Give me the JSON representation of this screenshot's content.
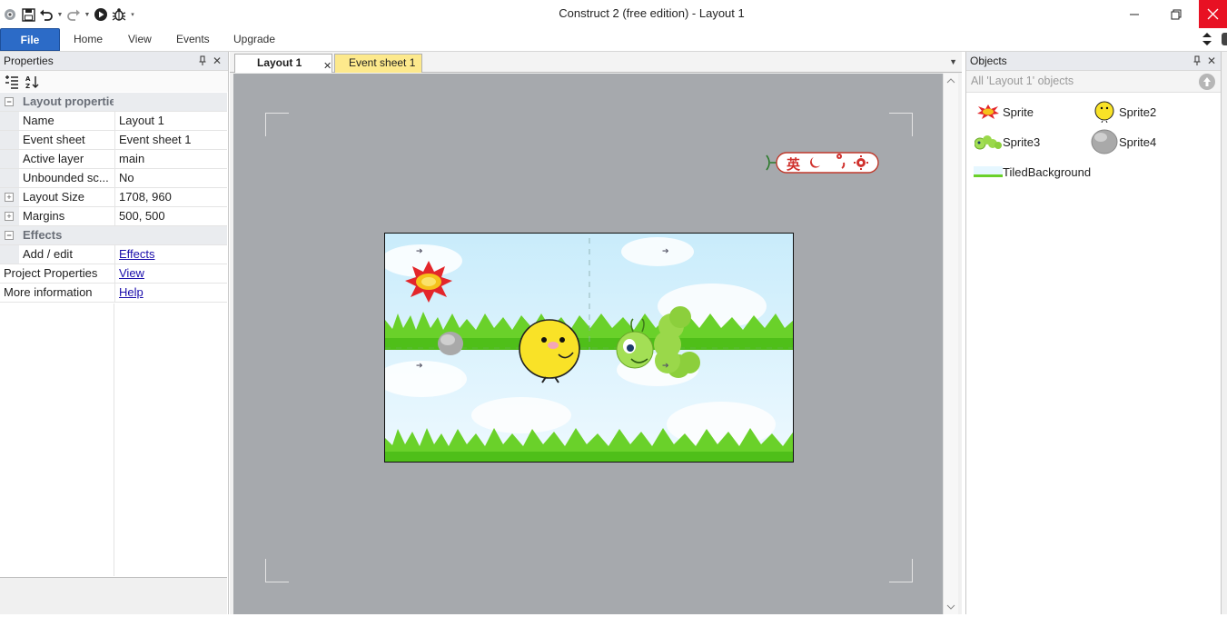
{
  "window": {
    "title": "Construct 2  (free edition) - Layout 1"
  },
  "ribbon": {
    "tabs": [
      "File",
      "Home",
      "View",
      "Events",
      "Upgrade"
    ]
  },
  "properties": {
    "header": "Properties",
    "categories": {
      "layout": "Layout properties",
      "effects": "Effects"
    },
    "rows": [
      {
        "name": "Name",
        "value": "Layout 1"
      },
      {
        "name": "Event sheet",
        "value": "Event sheet 1"
      },
      {
        "name": "Active layer",
        "value": "main"
      },
      {
        "name": "Unbounded sc...",
        "value": "No"
      },
      {
        "name": "Layout Size",
        "value": "1708, 960"
      },
      {
        "name": "Margins",
        "value": "500, 500"
      }
    ],
    "effects_row": {
      "name": "Add / edit",
      "value": "Effects"
    },
    "project_row": {
      "name": "Project Properties",
      "value": "View"
    },
    "info_row": {
      "name": "More information",
      "value": "Help"
    }
  },
  "document_tabs": {
    "layout": "Layout 1",
    "sheet": "Event sheet 1"
  },
  "ime_toolbar": {
    "label": "英"
  },
  "objects": {
    "header": "Objects",
    "filter": "All 'Layout 1' objects",
    "items": [
      "Sprite",
      "Sprite2",
      "Sprite3",
      "Sprite4",
      "TiledBackground"
    ]
  },
  "colors": {
    "file_tab": "#2c6bc7",
    "close_button": "#e81123",
    "canvas_bg": "#a6a9ad",
    "event_sheet_tab": "#fde98c",
    "link": "#1a0dab"
  },
  "icons": {
    "quick_access": [
      "construct-logo-icon",
      "save-icon",
      "undo-icon",
      "redo-icon",
      "play-icon",
      "debug-bug-icon"
    ]
  }
}
